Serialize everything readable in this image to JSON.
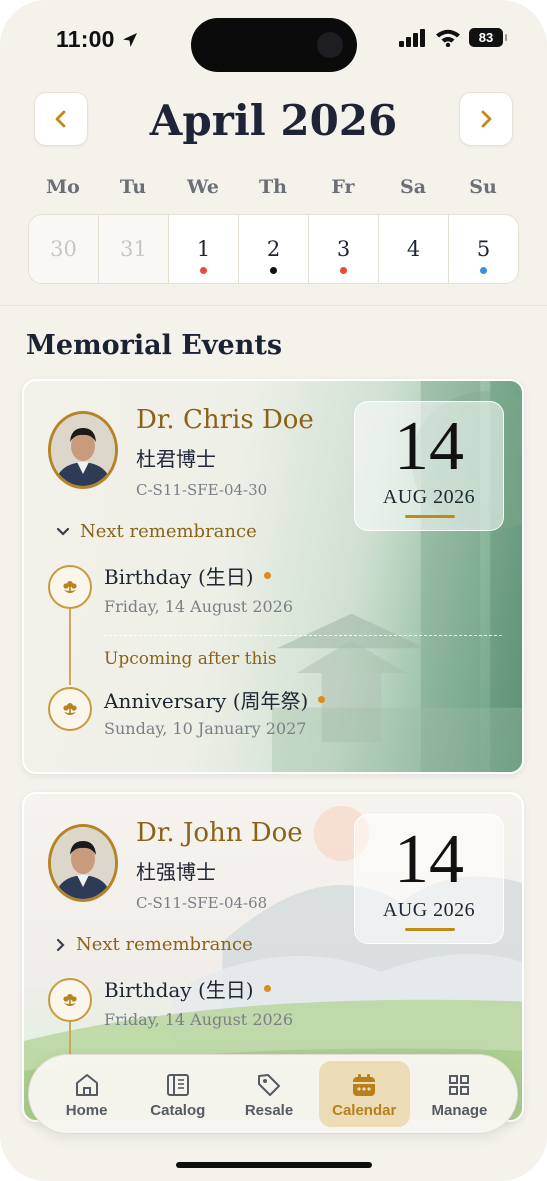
{
  "status": {
    "time": "11:00",
    "battery": "83"
  },
  "calendar": {
    "month_title": "April 2026",
    "weekdays": [
      "Mo",
      "Tu",
      "We",
      "Th",
      "Fr",
      "Sa",
      "Su"
    ],
    "days": [
      {
        "label": "30",
        "dot": ""
      },
      {
        "label": "31",
        "dot": ""
      },
      {
        "label": "1",
        "dot": "#e84a3c"
      },
      {
        "label": "2",
        "dot": "#111111"
      },
      {
        "label": "3",
        "dot": "#e84a3c"
      },
      {
        "label": "4",
        "dot": ""
      },
      {
        "label": "5",
        "dot": "#3b8fe0"
      }
    ]
  },
  "section_title": "Memorial Events",
  "cards": [
    {
      "name": "Dr. Chris Doe",
      "chinese_name": "杜君博士",
      "code": "C-S11-SFE-04-30",
      "date_day": "14",
      "date_month": "AUG 2026",
      "next_label": "Next remembrance",
      "event_title": "Birthday (生日)",
      "event_date": "Friday, 14 August 2026",
      "upcoming_label": "Upcoming after this",
      "upcoming_title": "Anniversary (周年祭)",
      "upcoming_date": "Sunday, 10 January 2027"
    },
    {
      "name": "Dr. John Doe",
      "chinese_name": "杜强博士",
      "code": "C-S11-SFE-04-68",
      "date_day": "14",
      "date_month": "AUG 2026",
      "next_label": "Next remembrance",
      "event_title": "Birthday (生日)",
      "event_date": "Friday, 14 August 2026"
    }
  ],
  "tabs": [
    {
      "label": "Home",
      "icon": "home-icon"
    },
    {
      "label": "Catalog",
      "icon": "book-icon"
    },
    {
      "label": "Resale",
      "icon": "tag-icon"
    },
    {
      "label": "Calendar",
      "icon": "calendar-icon",
      "active": true
    },
    {
      "label": "Manage",
      "icon": "grid-icon"
    }
  ],
  "colors": {
    "accent": "#c08a17",
    "accent_text": "#8a6318",
    "active_tab_bg": "#ecdcb7"
  }
}
